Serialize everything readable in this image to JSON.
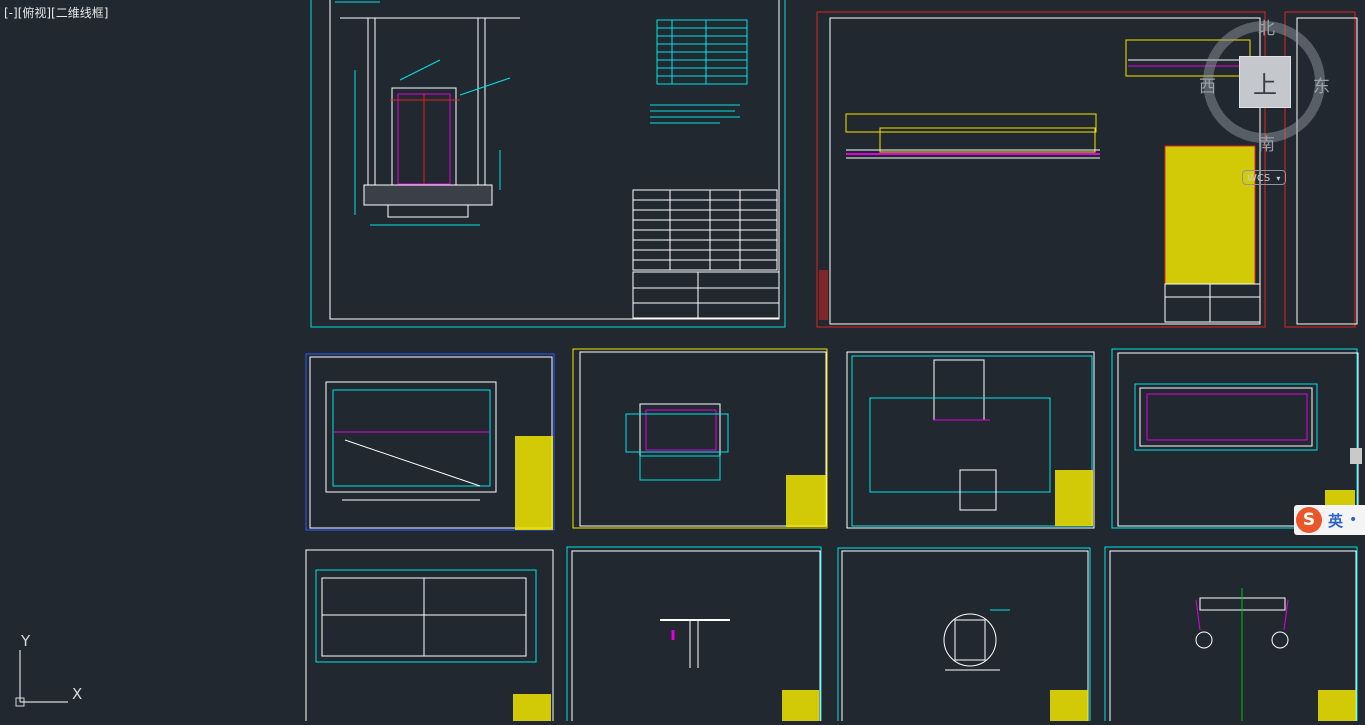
{
  "viewport": {
    "label": "[-][俯视][二维线框]"
  },
  "viewcube": {
    "north": "北",
    "south": "南",
    "east": "东",
    "west": "西",
    "top_face": "上",
    "wcs_label": "WCS"
  },
  "ime": {
    "logo": "S",
    "mode": "英",
    "indicator": "•"
  },
  "ucs": {
    "x_label": "X",
    "y_label": "Y"
  },
  "colors": {
    "background": "#212830",
    "cyan": "#00e5e5",
    "red": "#e0241c",
    "yellow": "#f2e600",
    "white": "#ffffff",
    "magenta": "#e000e0",
    "blue": "#2a5cff"
  }
}
